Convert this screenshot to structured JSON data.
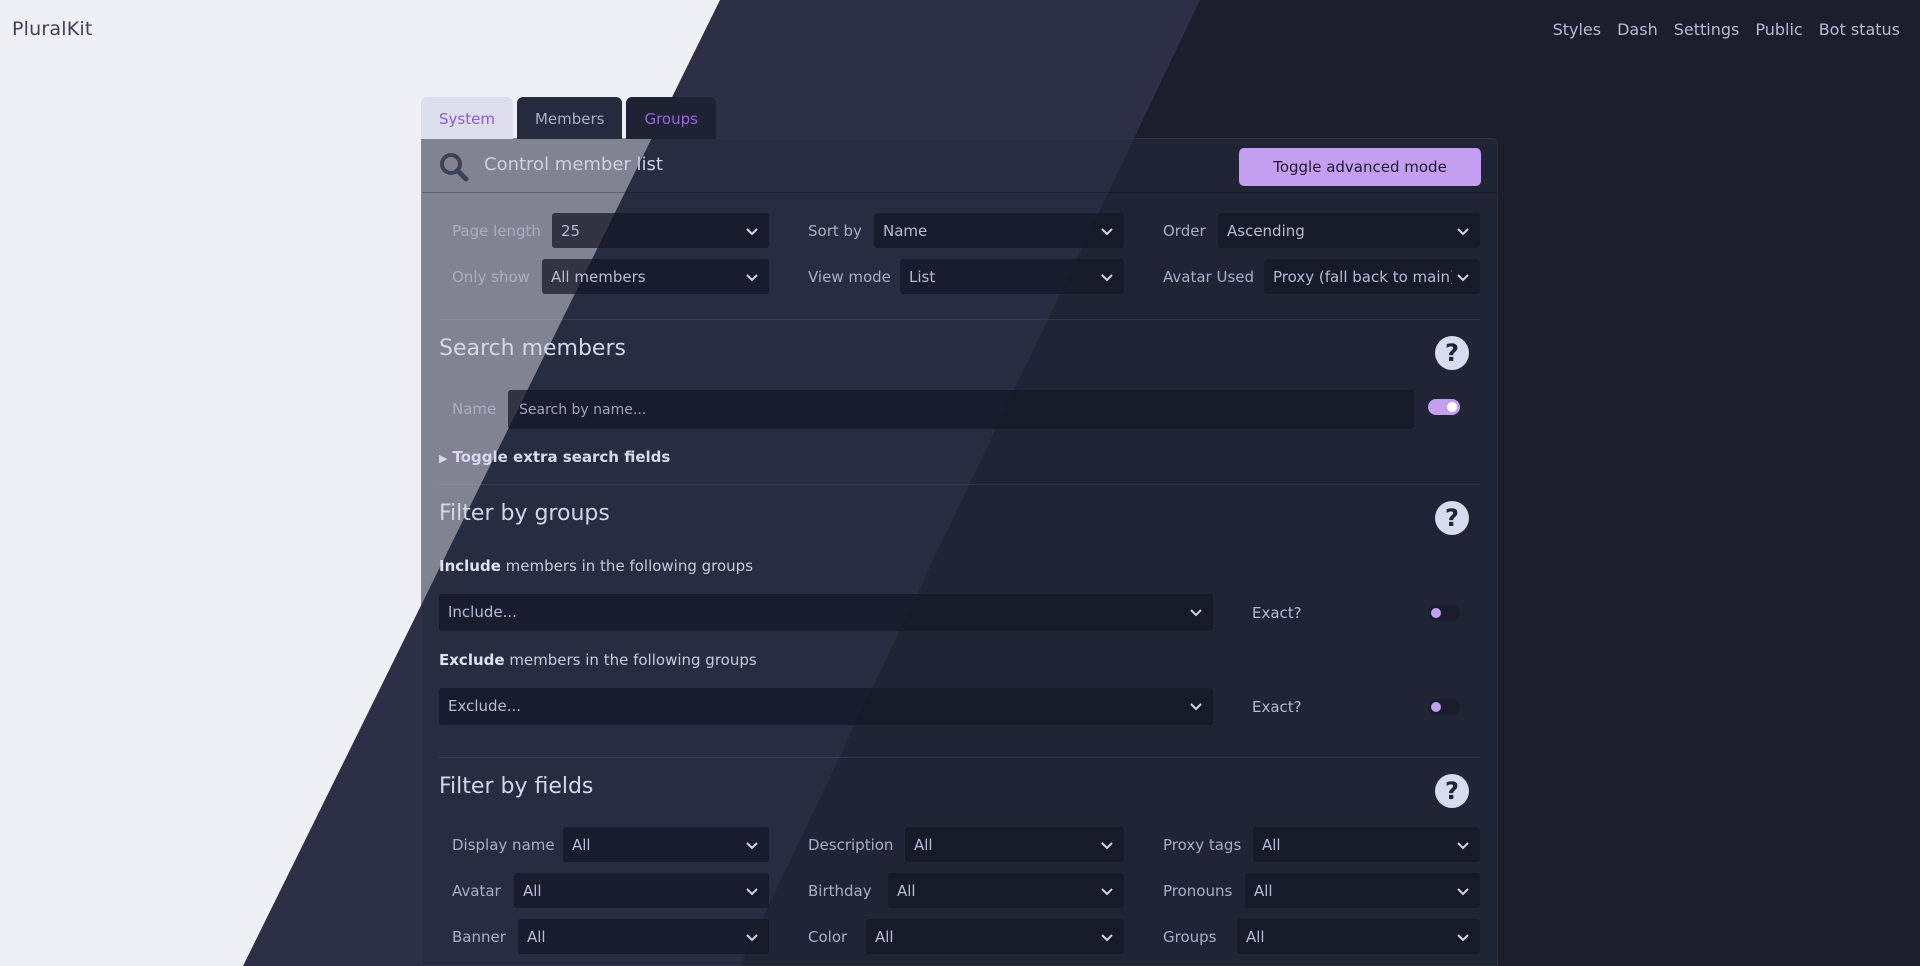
{
  "brand": "PluralKit",
  "nav": [
    "Styles",
    "Dash",
    "Settings",
    "Public",
    "Bot status"
  ],
  "tabs": {
    "system": "System",
    "members": "Members",
    "groups": "Groups"
  },
  "header": {
    "title": "Control member list",
    "icon": "search-icon",
    "advanced_button": "Toggle advanced mode"
  },
  "controls": {
    "page_length": {
      "label": "Page length",
      "value": "25"
    },
    "sort_by": {
      "label": "Sort by",
      "value": "Name"
    },
    "order": {
      "label": "Order",
      "value": "Ascending"
    },
    "only_show": {
      "label": "Only show",
      "value": "All members"
    },
    "view_mode": {
      "label": "View mode",
      "value": "List"
    },
    "avatar_used": {
      "label": "Avatar Used",
      "value": "Proxy (fall back to main)"
    }
  },
  "search": {
    "title": "Search members",
    "name_label": "Name",
    "placeholder": "Search by name...",
    "toggle_on": true,
    "extra_fields": "Toggle extra search fields"
  },
  "groups_filter": {
    "title": "Filter by groups",
    "include_bold": "Include",
    "include_text": " members in the following groups",
    "include_placeholder": "Include...",
    "exclude_bold": "Exclude",
    "exclude_text": " members in the following groups",
    "exclude_placeholder": "Exclude...",
    "exact_label": "Exact?"
  },
  "fields_filter": {
    "title": "Filter by fields",
    "display_name": {
      "label": "Display name",
      "value": "All"
    },
    "description": {
      "label": "Description",
      "value": "All"
    },
    "proxy_tags": {
      "label": "Proxy tags",
      "value": "All"
    },
    "avatar": {
      "label": "Avatar",
      "value": "All"
    },
    "birthday": {
      "label": "Birthday",
      "value": "All"
    },
    "pronouns": {
      "label": "Pronouns",
      "value": "All"
    },
    "banner": {
      "label": "Banner",
      "value": "All"
    },
    "color": {
      "label": "Color",
      "value": "All"
    },
    "groups": {
      "label": "Groups",
      "value": "All"
    }
  },
  "colors": {
    "accent": "#c49ef0",
    "light_bg": "#eff0f5",
    "dark_bg": "#181a2a"
  }
}
